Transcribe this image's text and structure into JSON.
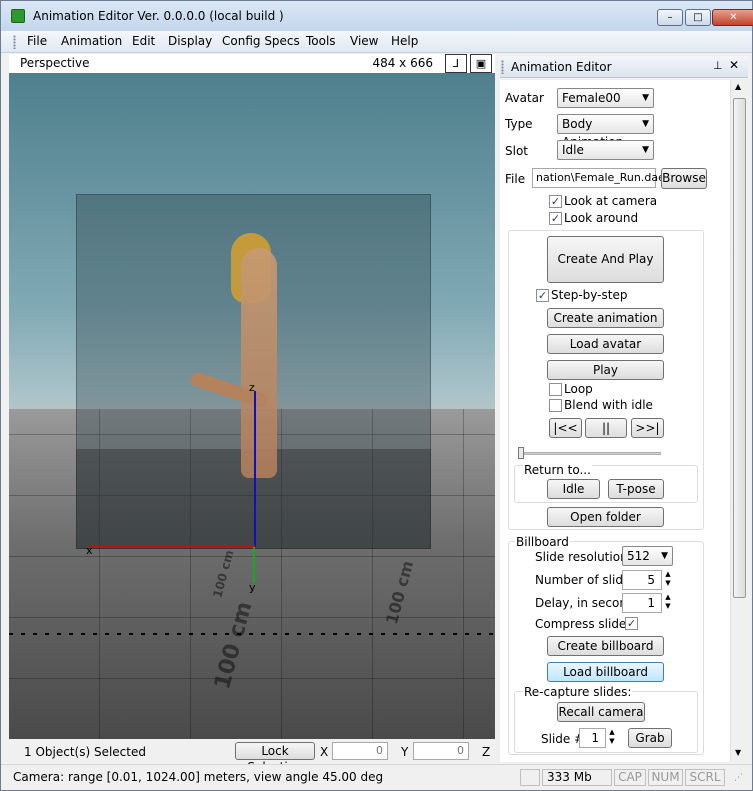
{
  "window": {
    "title": "Animation Editor Ver. 0.0.0.0 (local build )",
    "controls": {
      "minimize": "–",
      "maximize": "□",
      "close": "✕"
    }
  },
  "menu": [
    "File",
    "Animation",
    "Edit",
    "Display",
    "Config Specs",
    "Tools",
    "View",
    "Help"
  ],
  "viewport": {
    "label": "Perspective",
    "size": "484 x 666",
    "axis_labels": {
      "x": "x",
      "y": "y",
      "z": "z"
    },
    "floor_text": [
      "100 cm",
      "100 cm",
      "100 cm"
    ]
  },
  "viewport_status": {
    "selection": "1 Object(s) Selected",
    "lock_selection": "Lock Selection",
    "x_label": "X",
    "x_value": "0",
    "y_label": "Y",
    "y_value": "0",
    "z_label": "Z"
  },
  "panel": {
    "title": "Animation Editor",
    "avatar_label": "Avatar",
    "avatar_value": "Female00",
    "type_label": "Type",
    "type_value": "Body Animation",
    "slot_label": "Slot",
    "slot_value": "Idle",
    "file_label": "File",
    "file_value": "nation\\Female_Run.dae",
    "browse": "Browse",
    "look_at_camera": "Look at camera",
    "look_around": "Look around",
    "create_and_play": "Create And Play",
    "step_by_step": "Step-by-step",
    "create_animation": "Create animation",
    "load_avatar": "Load avatar",
    "play": "Play",
    "loop": "Loop",
    "blend_with_idle": "Blend with idle",
    "first": "|<<",
    "pause": "||",
    "last": ">>|",
    "return_to": "Return to...",
    "idle": "Idle",
    "t_pose": "T-pose",
    "open_folder": "Open folder",
    "billboard": "Billboard",
    "slide_resolution_label": "Slide resolution",
    "slide_resolution_value": "512",
    "num_slides_label": "Number of slides",
    "num_slides_value": "5",
    "delay_label": "Delay, in seconds",
    "delay_value": "1",
    "compress_slides": "Compress slides",
    "create_billboard": "Create billboard",
    "load_billboard": "Load billboard",
    "recapture": "Re-capture slides:",
    "recall_camera": "Recall camera",
    "slide_num_label": "Slide #",
    "slide_num_value": "1",
    "grab": "Grab"
  },
  "statusbar": {
    "camera": "Camera: range [0.01, 1024.00] meters, view angle 45.00 deg",
    "memory": "333 Mb",
    "cap": "CAP",
    "num": "NUM",
    "scrl": "SCRL"
  },
  "checkboxes": {
    "look_at_camera": true,
    "look_around": true,
    "step_by_step": true,
    "loop": false,
    "blend_with_idle": false,
    "compress_slides": true
  }
}
